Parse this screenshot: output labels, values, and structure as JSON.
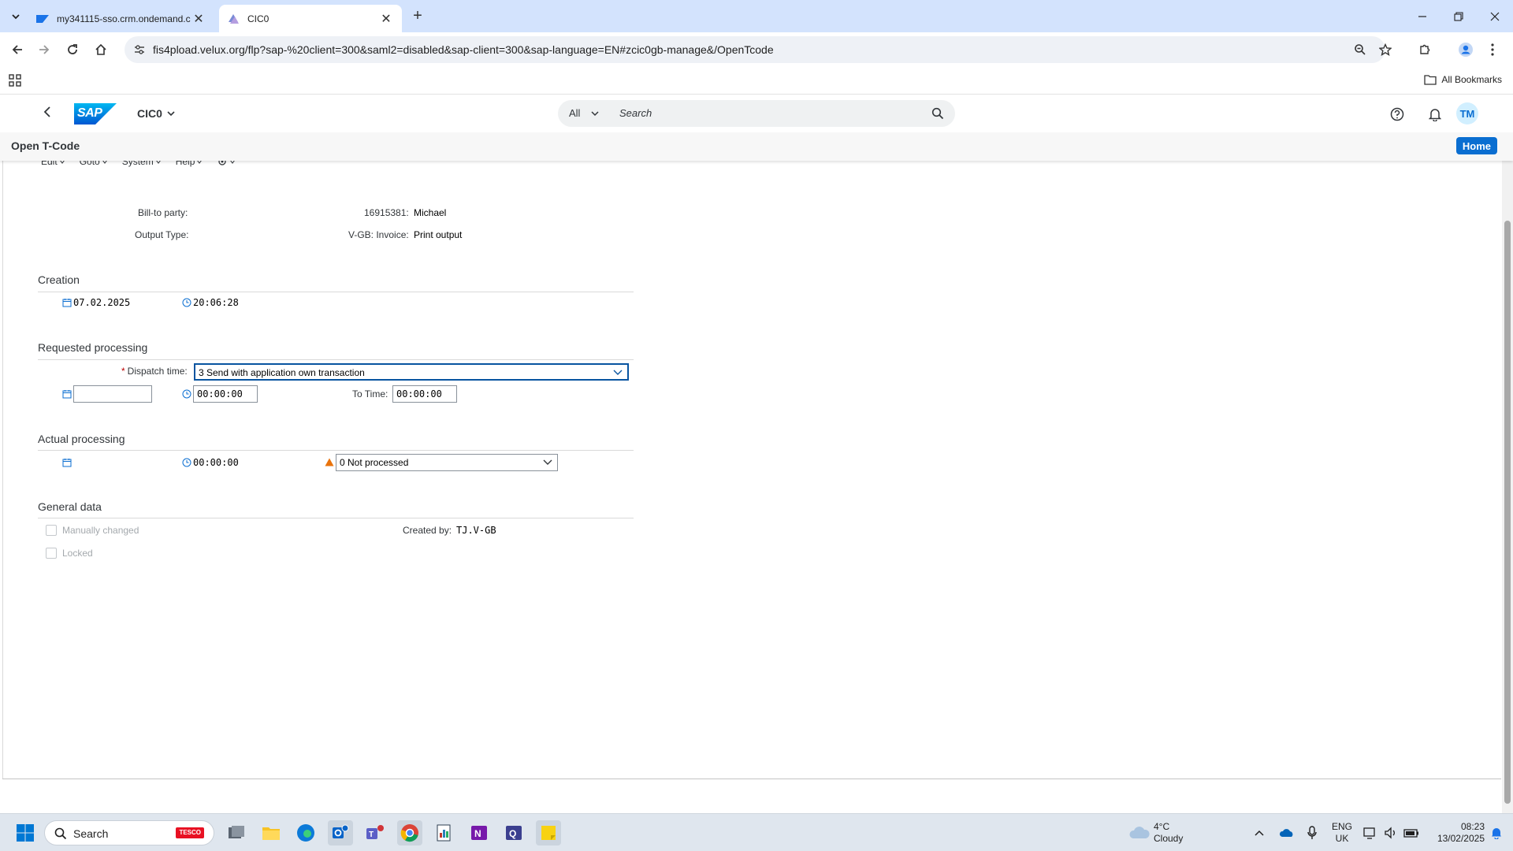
{
  "browser": {
    "tabs": [
      {
        "title": "my341115-sso.crm.ondemand.c",
        "active": false
      },
      {
        "title": "CIC0",
        "active": true
      }
    ],
    "url": "fis4pload.velux.org/flp?sap-%20client=300&saml2=disabled&sap-client=300&sap-language=EN#zcic0gb-manage&/OpenTcode",
    "bookmarks_label": "All Bookmarks"
  },
  "shell": {
    "app_title": "CIC0",
    "logo_text": "SAP",
    "search_scope": "All",
    "search_placeholder": "Search",
    "avatar_initials": "TM"
  },
  "subheader": {
    "title": "Open T-Code",
    "home_label": "Home"
  },
  "menu": [
    "Edit",
    "Goto",
    "System",
    "Help"
  ],
  "header_fields": {
    "bill_to_label": "Bill-to party:",
    "bill_to_number": "16915381:",
    "bill_to_name": "Michael",
    "output_type_label": "Output Type:",
    "output_type_code": "V-GB: Invoice:",
    "output_type_desc": "Print output"
  },
  "creation": {
    "title": "Creation",
    "date": "07.02.2025",
    "time": "20:06:28"
  },
  "requested": {
    "title": "Requested processing",
    "dispatch_label": "Dispatch time:",
    "dispatch_value": "3 Send with application own transaction",
    "date_value": "",
    "time_value": "00:00:00",
    "to_time_label": "To Time:",
    "to_time_value": "00:00:00"
  },
  "actual": {
    "title": "Actual processing",
    "time": "00:00:00",
    "status_value": "0 Not processed"
  },
  "general": {
    "title": "General data",
    "manually_changed": "Manually changed",
    "locked": "Locked",
    "created_by_label": "Created by:",
    "created_by_value": "TJ.V-GB"
  },
  "taskbar": {
    "search_placeholder": "Search",
    "search_tag": "TESCO",
    "weather_temp": "4°C",
    "weather_desc": "Cloudy",
    "lang_line1": "ENG",
    "lang_line2": "UK",
    "clock_time": "08:23",
    "clock_date": "13/02/2025"
  }
}
